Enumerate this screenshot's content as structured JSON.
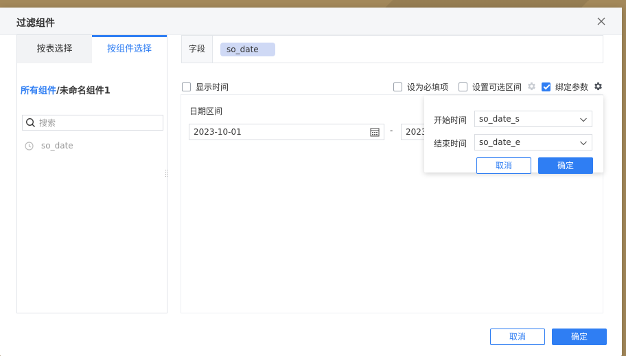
{
  "dialog": {
    "title": "过滤组件"
  },
  "left": {
    "tabs": [
      {
        "label": "按表选择"
      },
      {
        "label": "按组件选择"
      }
    ],
    "breadcrumb": {
      "link": "所有组件",
      "current": "/未命名组件1"
    },
    "search": {
      "placeholder": "搜索"
    },
    "fields": [
      {
        "label": "so_date"
      }
    ]
  },
  "field_row": {
    "label": "字段",
    "value": "so_date"
  },
  "options": {
    "show_time": {
      "label": "显示时间",
      "checked": false
    },
    "required": {
      "label": "设为必填项",
      "checked": false
    },
    "optional_range": {
      "label": "设置可选区间",
      "checked": false
    },
    "bind_params": {
      "label": "绑定参数",
      "checked": true
    }
  },
  "preview": {
    "title": "日期区间",
    "start_value": "2023-10-01",
    "separator": "-",
    "end_value": "2023"
  },
  "popover": {
    "start": {
      "label": "开始时间",
      "value": "so_date_s"
    },
    "end": {
      "label": "结束时间",
      "value": "so_date_e"
    },
    "cancel_label": "取消",
    "confirm_label": "确定"
  },
  "footer": {
    "cancel_label": "取消",
    "confirm_label": "确定"
  },
  "colors": {
    "accent": "#2f7ef3",
    "tag_bg": "#cfd9f5"
  }
}
